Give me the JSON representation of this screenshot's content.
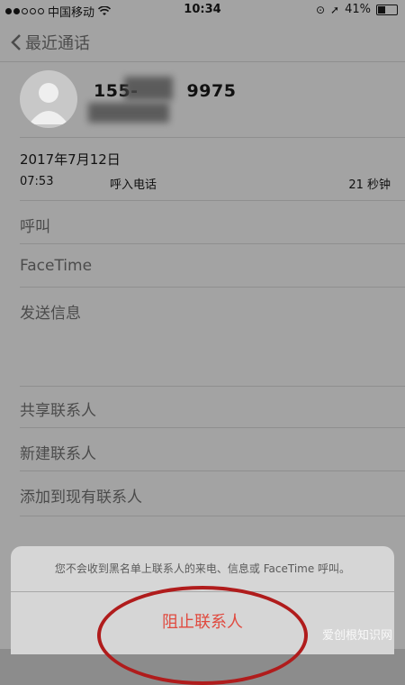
{
  "status_bar": {
    "carrier": "中国移动",
    "time": "10:34",
    "battery": "41%",
    "battery_fraction": 0.41
  },
  "nav": {
    "back_label": "最近通话"
  },
  "contact": {
    "phone_prefix": "155-",
    "phone_suffix": "9975"
  },
  "call_log": {
    "date": "2017年7月12日",
    "time": "07:53",
    "type": "呼入电话",
    "duration": "21 秒钟"
  },
  "actions": {
    "call": "呼叫",
    "facetime": "FaceTime",
    "message": "发送信息",
    "share": "共享联系人",
    "new_contact": "新建联系人",
    "add_existing": "添加到现有联系人"
  },
  "sheet": {
    "message": "您不会收到黑名单上联系人的来电、信息或 FaceTime 呼叫。",
    "block_button": "阻止联系人"
  },
  "watermark": "爱创根知识网"
}
